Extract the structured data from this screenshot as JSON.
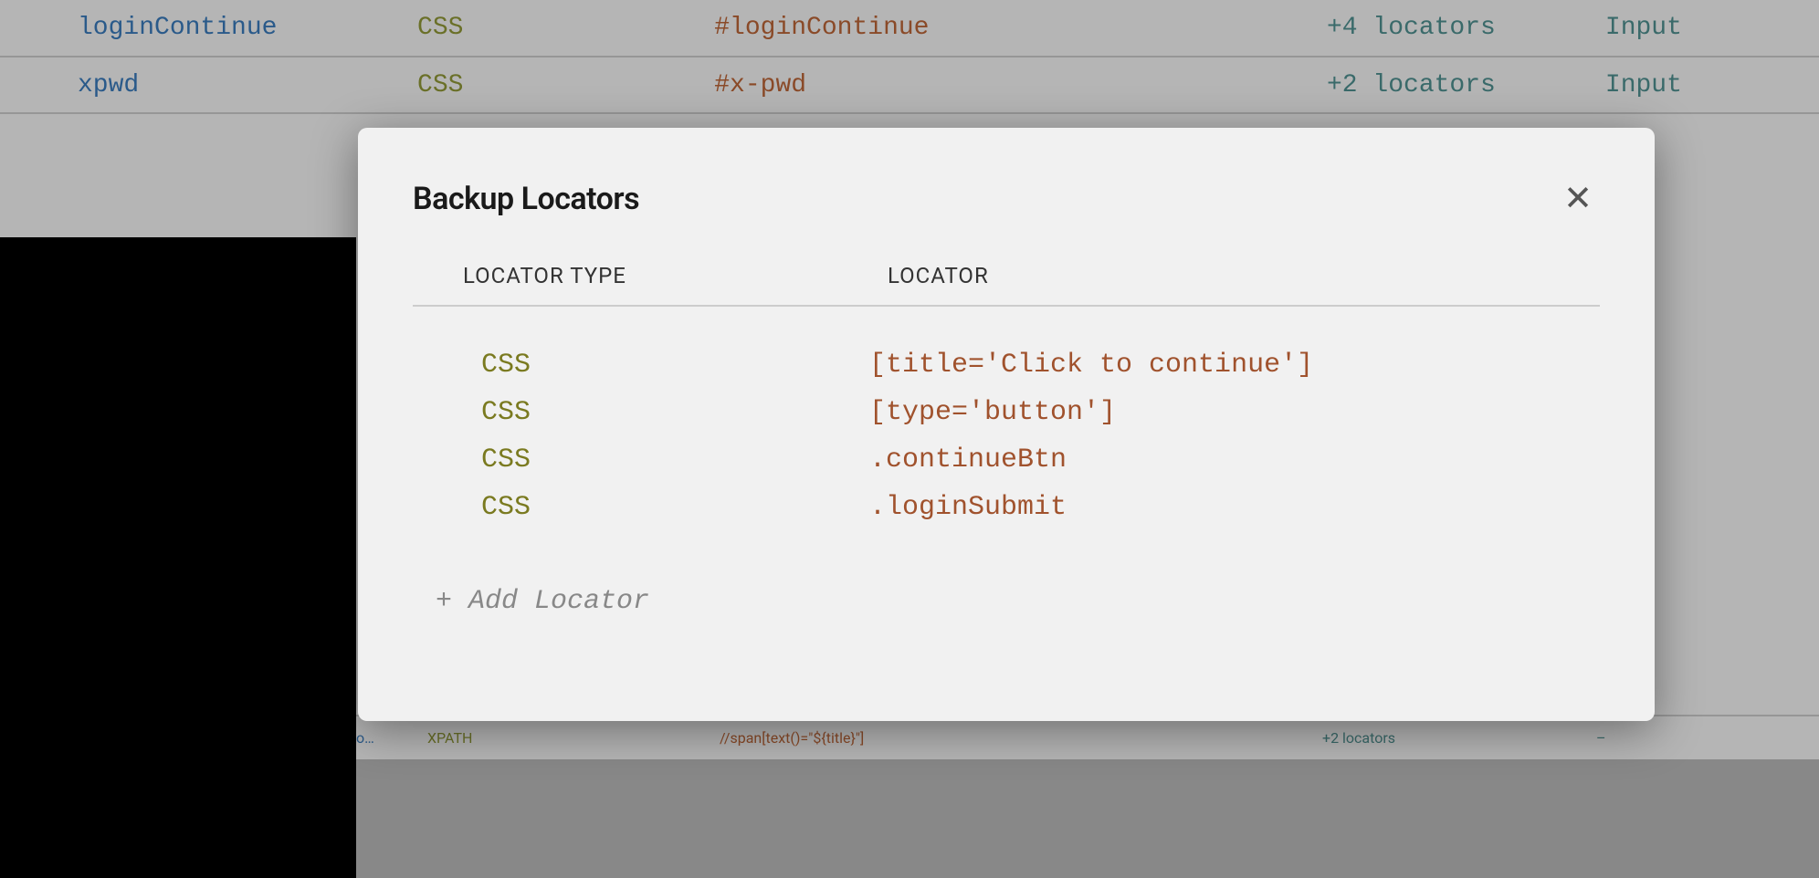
{
  "background_table": {
    "rows": [
      {
        "name": "loginContinue",
        "type": "CSS",
        "locator": "#loginContinue",
        "count": "+4 locators",
        "elem": "Input"
      },
      {
        "name": "xpwd",
        "type": "CSS",
        "locator": "#x-pwd",
        "count": "+2 locators",
        "elem": "Input"
      }
    ],
    "bottom_row": {
      "name": "o…",
      "type": "XPATH",
      "locator": "//span[text()=\"${title}\"]",
      "count": "+2 locators",
      "elem": "–"
    }
  },
  "modal": {
    "title": "Backup Locators",
    "header_col1": "LOCATOR TYPE",
    "header_col2": "LOCATOR",
    "rows": [
      {
        "type": "CSS",
        "locator": "[title='Click to continue']"
      },
      {
        "type": "CSS",
        "locator": "[type='button']"
      },
      {
        "type": "CSS",
        "locator": ".continueBtn"
      },
      {
        "type": "CSS",
        "locator": ".loginSubmit"
      }
    ],
    "add_label": "+ Add Locator",
    "close_label": "✕"
  }
}
